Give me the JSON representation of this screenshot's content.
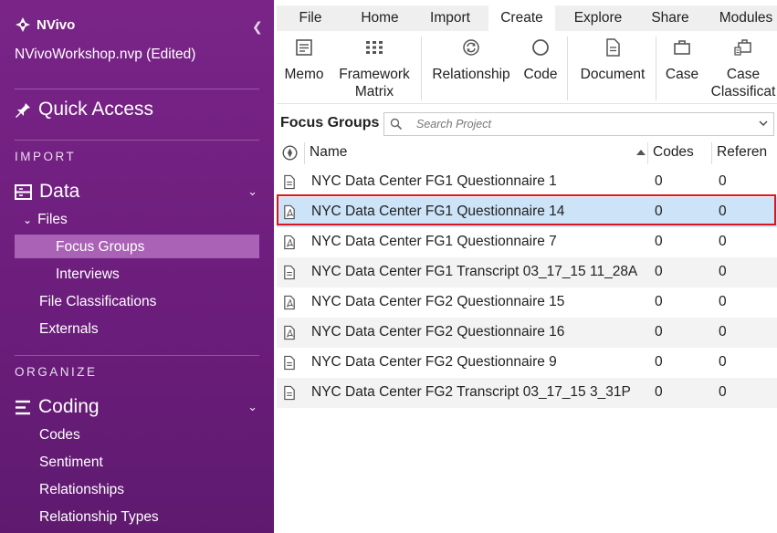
{
  "sidebar": {
    "brand": "NVivo",
    "project": "NVivoWorkshop.nvp (Edited)",
    "quick_access": "Quick Access",
    "sections": {
      "import": "IMPORT",
      "organize": "ORGANIZE"
    },
    "data_group": "Data",
    "files": "Files",
    "focus_groups": "Focus Groups",
    "interviews": "Interviews",
    "file_classifications": "File Classifications",
    "externals": "Externals",
    "coding_group": "Coding",
    "codes": "Codes",
    "sentiment": "Sentiment",
    "relationships": "Relationships",
    "relationship_types": "Relationship Types"
  },
  "ribbon": {
    "tabs": [
      "File",
      "Home",
      "Import",
      "Create",
      "Explore",
      "Share",
      "Modules"
    ],
    "active_tab": "Create",
    "buttons": {
      "memo": "Memo",
      "framework": "Framework",
      "matrix": "Matrix",
      "relationship": "Relationship",
      "code": "Code",
      "document": "Document",
      "case": "Case",
      "case_class_1": "Case",
      "case_class_2": "Classificat"
    }
  },
  "folder": {
    "title": "Focus Groups",
    "search_placeholder": "Search Project"
  },
  "table": {
    "headers": {
      "name": "Name",
      "codes": "Codes",
      "refs": "Referen"
    },
    "rows": [
      {
        "name": "NYC Data Center FG1 Questionnaire 1",
        "codes": "0",
        "refs": "0",
        "icon": "document-icon"
      },
      {
        "name": "NYC Data Center FG1 Questionnaire 14",
        "codes": "0",
        "refs": "0",
        "icon": "pdf-icon"
      },
      {
        "name": "NYC Data Center FG1 Questionnaire 7",
        "codes": "0",
        "refs": "0",
        "icon": "pdf-icon"
      },
      {
        "name": "NYC Data Center FG1 Transcript 03_17_15 11_28A",
        "codes": "0",
        "refs": "0",
        "icon": "document-icon"
      },
      {
        "name": "NYC Data Center FG2 Questionnaire 15",
        "codes": "0",
        "refs": "0",
        "icon": "pdf-icon"
      },
      {
        "name": "NYC Data Center FG2 Questionnaire 16",
        "codes": "0",
        "refs": "0",
        "icon": "pdf-icon"
      },
      {
        "name": "NYC Data Center FG2 Questionnaire 9",
        "codes": "0",
        "refs": "0",
        "icon": "document-icon"
      },
      {
        "name": "NYC Data Center FG2 Transcript 03_17_15 3_31P",
        "codes": "0",
        "refs": "0",
        "icon": "document-icon"
      }
    ],
    "selected_row": 1
  },
  "colors": {
    "sidebar": "#6b1d7b",
    "sidebar_selected": "#a962b5",
    "row_selected": "#cce3f8",
    "highlight_border": "#e0141e"
  }
}
